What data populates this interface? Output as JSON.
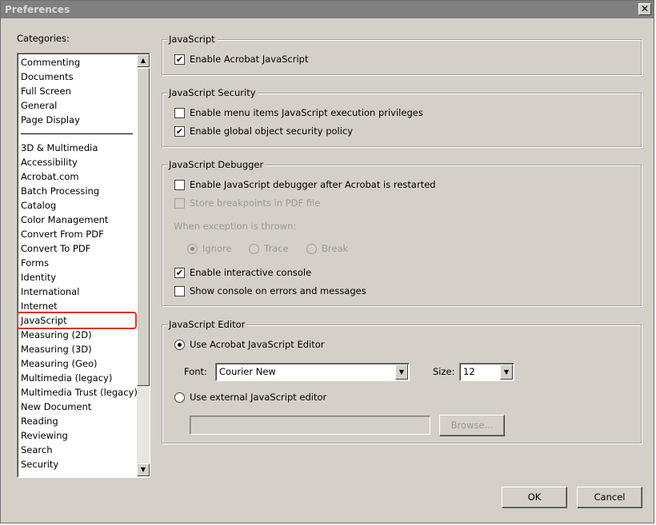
{
  "window": {
    "title": "Preferences",
    "close_glyph": "✕"
  },
  "categories": {
    "label": "Categories:",
    "group1": [
      "Commenting",
      "Documents",
      "Full Screen",
      "General",
      "Page Display"
    ],
    "group2": [
      "3D & Multimedia",
      "Accessibility",
      "Acrobat.com",
      "Batch Processing",
      "Catalog",
      "Color Management",
      "Convert From PDF",
      "Convert To PDF",
      "Forms",
      "Identity",
      "International",
      "Internet",
      "JavaScript",
      "Measuring (2D)",
      "Measuring (3D)",
      "Measuring (Geo)",
      "Multimedia (legacy)",
      "Multimedia Trust (legacy)",
      "New Document",
      "Reading",
      "Reviewing",
      "Search",
      "Security"
    ],
    "selected": "JavaScript",
    "scroll_up_icon": "▲",
    "scroll_down_icon": "▼"
  },
  "javascript": {
    "title": "JavaScript",
    "enable_acrobat_js": {
      "label": "Enable Acrobat JavaScript",
      "checked": true
    }
  },
  "security": {
    "title": "JavaScript Security",
    "menu_items_privileges": {
      "label": "Enable menu items JavaScript execution privileges",
      "checked": false
    },
    "global_object_policy": {
      "label": "Enable global object security policy",
      "checked": true
    }
  },
  "debugger": {
    "title": "JavaScript Debugger",
    "enable_debugger": {
      "label": "Enable JavaScript debugger after Acrobat is restarted",
      "checked": false
    },
    "store_breakpoints": {
      "label": "Store breakpoints in PDF file",
      "checked": false,
      "disabled": true
    },
    "exception_label": "When exception is thrown:",
    "exception_options": [
      "Ignore",
      "Trace",
      "Break"
    ],
    "exception_selected": "Ignore",
    "interactive_console": {
      "label": "Enable interactive console",
      "checked": true
    },
    "show_console": {
      "label": "Show console on errors and messages",
      "checked": false
    }
  },
  "editor": {
    "title": "JavaScript Editor",
    "use_acrobat_editor": {
      "label": "Use Acrobat JavaScript Editor",
      "selected": true
    },
    "font_label": "Font:",
    "font_value": "Courier New",
    "size_label": "Size:",
    "size_value": "12",
    "use_external_editor": {
      "label": "Use external JavaScript editor",
      "selected": false
    },
    "external_path": "",
    "browse_label": "Browse...",
    "dropdown_icon": "▼"
  },
  "footer": {
    "ok_label": "OK",
    "cancel_label": "Cancel"
  },
  "colors": {
    "dialog_bg": "#d4d0c8",
    "titlebar": "#808080",
    "selection_outline": "#d9342b",
    "disabled_text": "#9a9a9a"
  },
  "check_glyph": "✔"
}
